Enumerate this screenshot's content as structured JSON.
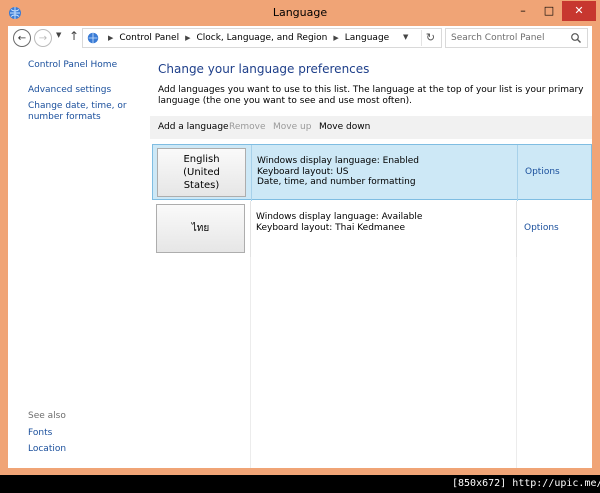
{
  "window": {
    "title": "Language",
    "controls": {
      "minimize": "–",
      "maximize": "□",
      "close": "✕"
    }
  },
  "navigation": {
    "breadcrumbs": [
      "Control Panel",
      "Clock, Language, and Region",
      "Language"
    ],
    "search_placeholder": "Search Control Panel"
  },
  "sidebar": {
    "home": "Control Panel Home",
    "advanced": "Advanced settings",
    "date_formats": "Change date, time, or number formats",
    "see_also": "See also",
    "fonts": "Fonts",
    "location": "Location"
  },
  "main": {
    "title": "Change your language preferences",
    "description": "Add languages you want to use to this list. The language at the top of your list is your primary language (the one you want to see and use most often).",
    "toolbar": {
      "add": "Add a language",
      "remove": "Remove",
      "move_up": "Move up",
      "move_down": "Move down"
    },
    "languages": [
      {
        "name": "English (United States)",
        "line1": "Windows display language: Enabled",
        "line2": "Keyboard layout: US",
        "line3": "Date, time, and number formatting",
        "options": "Options"
      },
      {
        "name": "ไทย",
        "line1": "Windows display language: Available",
        "line2": "Keyboard layout: Thai Kedmanee",
        "line3": "",
        "options": "Options"
      }
    ]
  },
  "watermark": "[850x672] http://upic.me/",
  "colors": {
    "frame": "#f0a476",
    "close_button": "#c7372f",
    "link": "#1a4f9c",
    "title": "#1e3f8a",
    "selected_row": "#cde8f6",
    "selected_border": "#7fbde2"
  }
}
